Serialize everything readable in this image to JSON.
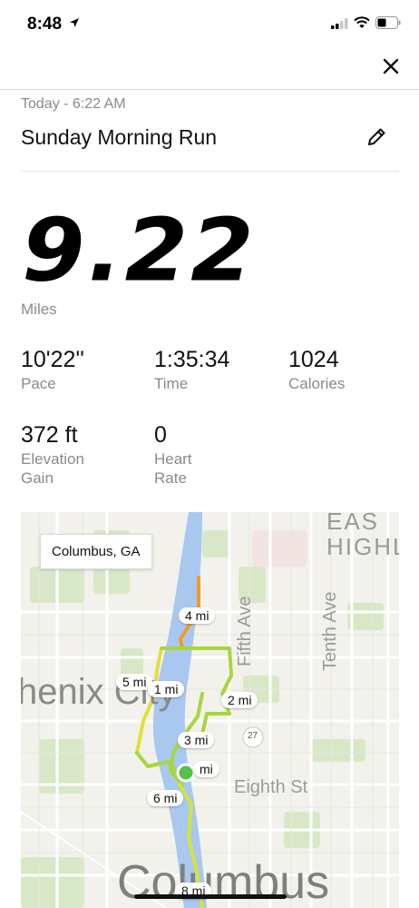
{
  "status_bar": {
    "time": "8:48"
  },
  "header": {
    "date_line": "Today - 6:22 AM",
    "title": "Sunday Morning Run"
  },
  "summary": {
    "distance": "9.22",
    "distance_unit": "Miles"
  },
  "stats": [
    {
      "value": "10'22''",
      "label": "Pace"
    },
    {
      "value": "1:35:34",
      "label": "Time"
    },
    {
      "value": "1024",
      "label": "Calories"
    },
    {
      "value": "372 ft",
      "label": "Elevation Gain"
    },
    {
      "value": "0",
      "label": "Heart Rate"
    }
  ],
  "map": {
    "location": "Columbus, GA",
    "mile_markers": [
      "4 mi",
      "5 mi",
      "1 mi",
      "2 mi",
      "3 mi",
      "mi",
      "6 mi",
      "8 mi"
    ],
    "labels": {
      "east_highlands": "EAS HIGHL",
      "fifth_ave": "Fifth Ave",
      "tenth_ave": "Tenth Ave",
      "phenix_city": "henix City",
      "eighth_st": "Eighth St",
      "columbus": "Columbus",
      "highway": "27"
    },
    "route_colors": {
      "green": "#a8d63c",
      "yellow": "#e2df3c",
      "orange": "#f19a2a"
    }
  },
  "icons": {
    "close": "close-icon",
    "edit": "pencil-icon",
    "location": "location-arrow-icon",
    "signal": "cell-signal-icon",
    "wifi": "wifi-icon",
    "battery": "battery-icon"
  }
}
